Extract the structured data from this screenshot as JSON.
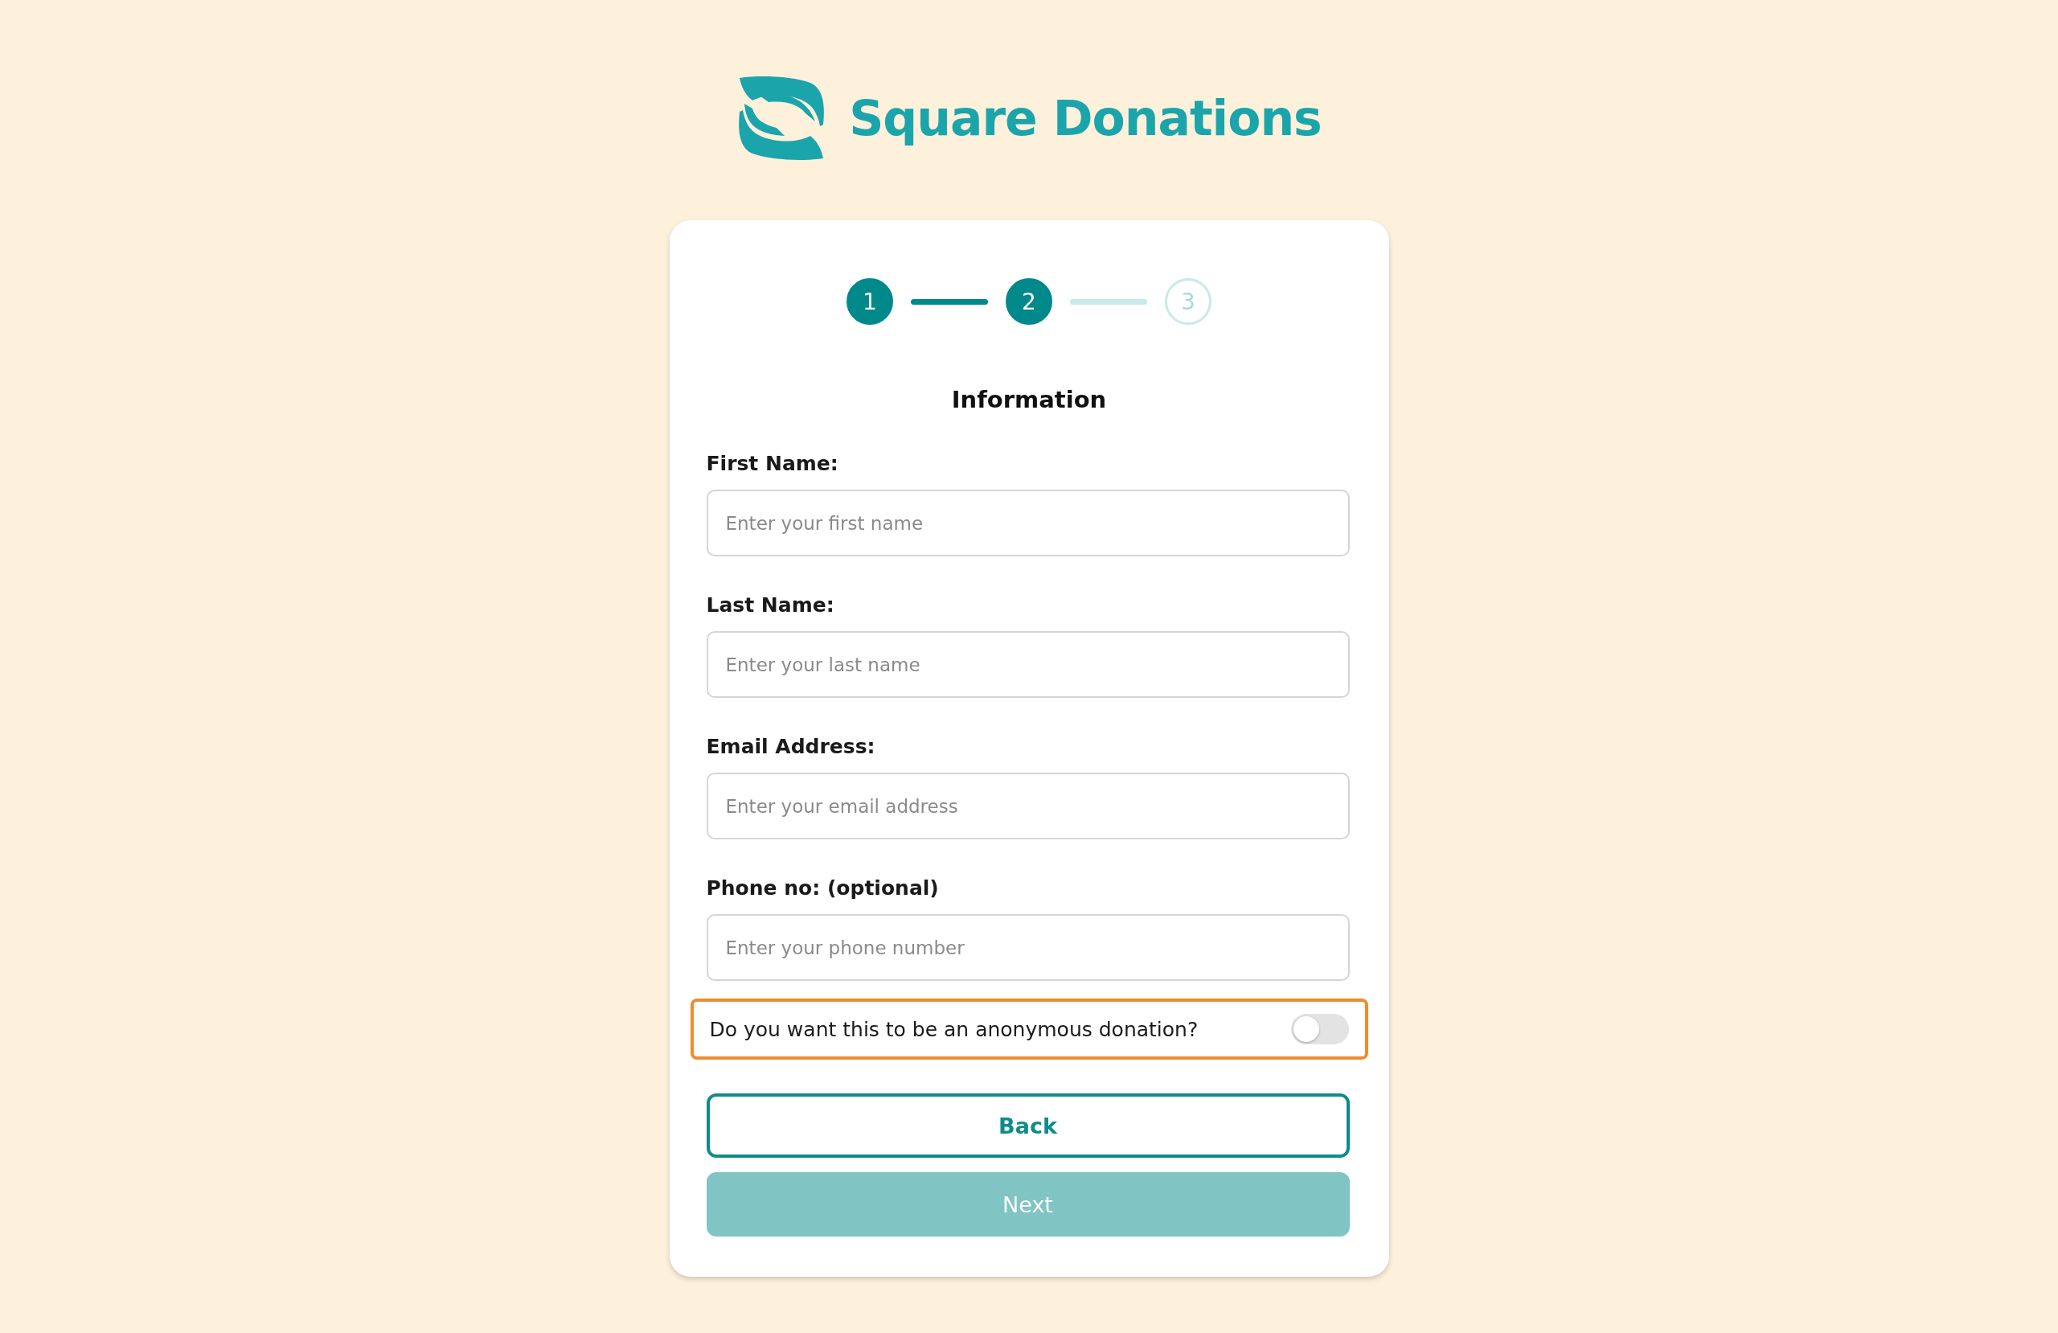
{
  "brand": {
    "name": "Square Donations"
  },
  "steps": [
    {
      "label": "1",
      "reached": true
    },
    {
      "label": "2",
      "reached": true
    },
    {
      "label": "3",
      "reached": false
    }
  ],
  "form": {
    "title": "Information",
    "fields": [
      {
        "label": "First Name:",
        "placeholder": "Enter your first name"
      },
      {
        "label": "Last Name:",
        "placeholder": "Enter your last name"
      },
      {
        "label": "Email Address:",
        "placeholder": "Enter your email address"
      },
      {
        "label": "Phone no: (optional)",
        "placeholder": "Enter your phone number"
      }
    ],
    "anonymous": {
      "label": "Do you want this to be an anonymous donation?",
      "on": false,
      "focused": true
    },
    "buttons": [
      {
        "label": "Back",
        "kind": "outline",
        "disabled": false
      },
      {
        "label": "Next",
        "kind": "primary",
        "disabled": true
      }
    ]
  }
}
